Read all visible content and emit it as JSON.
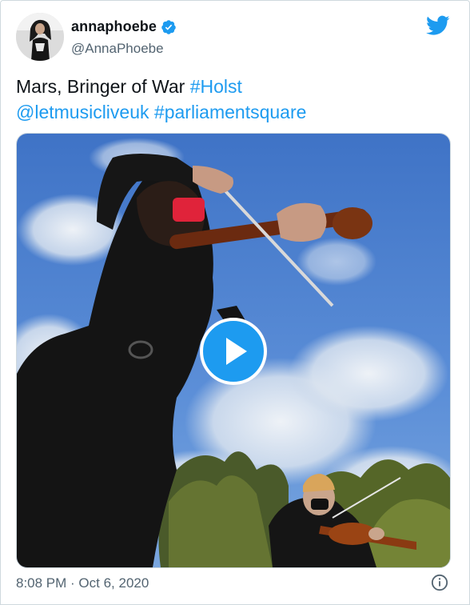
{
  "author": {
    "display_name": "annaphoebe",
    "handle": "@AnnaPhoebe",
    "verified_icon": "verified-badge-icon",
    "avatar": "profile-photo"
  },
  "brand": {
    "logo_icon": "twitter-bird-icon",
    "accent_color": "#1d9bf0"
  },
  "tweet": {
    "text_plain": "Mars, Bringer of War",
    "hashtag_1": "#Holst",
    "mention": "@letmusicliveuk",
    "hashtag_2": "#parliamentsquare"
  },
  "media": {
    "type": "video",
    "play_icon": "play-icon"
  },
  "footer": {
    "timestamp": "8:08 PM · Oct 6, 2020",
    "info_icon": "info-icon"
  }
}
